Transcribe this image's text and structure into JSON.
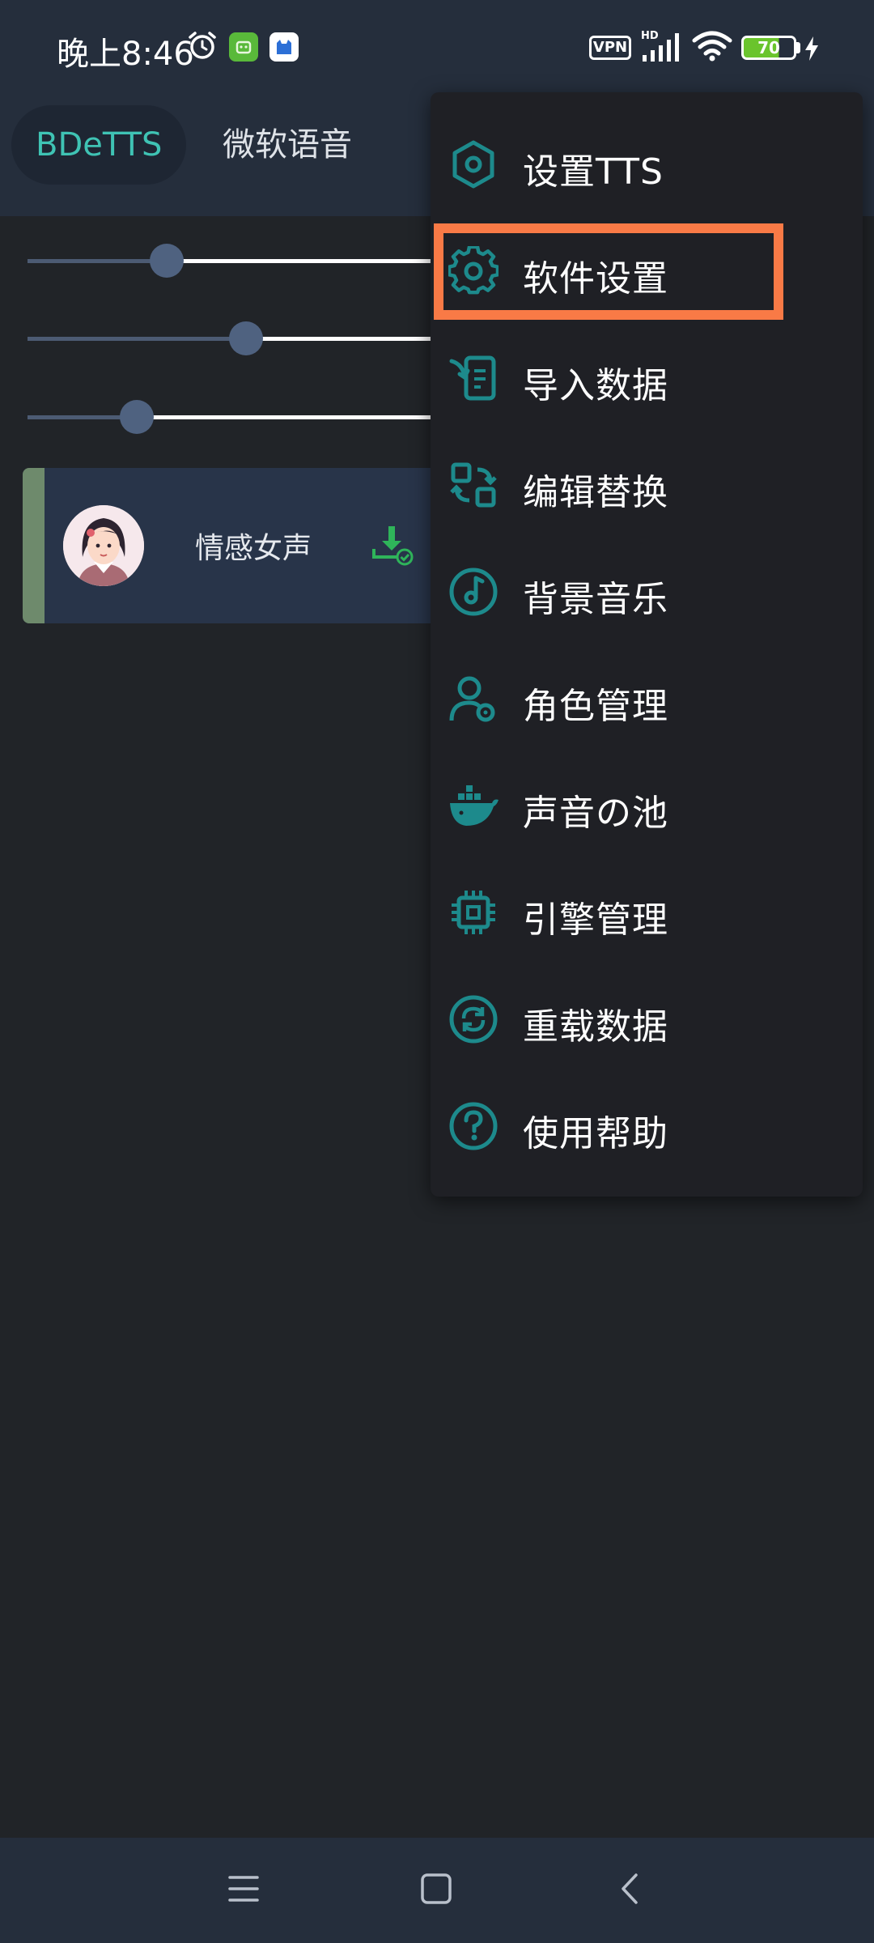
{
  "status_bar": {
    "time": "晚上8:46",
    "vpn": "VPN",
    "network": "HD",
    "battery": "70"
  },
  "tabs": [
    {
      "label": "BDeTTS",
      "active": true
    },
    {
      "label": "微软语音",
      "active": false
    }
  ],
  "sliders": [
    {
      "name": "rate",
      "fraction": 0.33
    },
    {
      "name": "pitch",
      "fraction": 0.52
    },
    {
      "name": "volume",
      "fraction": 0.26
    }
  ],
  "voice_card": {
    "name": "情感女声"
  },
  "menu": {
    "items": [
      {
        "label": "设置TTS",
        "icon": "hexagon-settings-icon"
      },
      {
        "label": "软件设置",
        "icon": "gear-icon"
      },
      {
        "label": "导入数据",
        "icon": "import-icon"
      },
      {
        "label": "编辑替换",
        "icon": "replace-icon"
      },
      {
        "label": "背景音乐",
        "icon": "music-disc-icon"
      },
      {
        "label": "角色管理",
        "icon": "user-settings-icon"
      },
      {
        "label": "声音の池",
        "icon": "whale-icon"
      },
      {
        "label": "引擎管理",
        "icon": "chip-icon"
      },
      {
        "label": "重载数据",
        "icon": "reload-icon"
      },
      {
        "label": "使用帮助",
        "icon": "help-icon"
      }
    ],
    "highlighted_index": 1
  },
  "colors": {
    "accent": "#3fc3b4",
    "icon": "#1d8a8c",
    "highlight": "#f97a46"
  },
  "nav_bar": {
    "buttons": [
      "menu-icon",
      "home-icon",
      "back-icon"
    ]
  }
}
